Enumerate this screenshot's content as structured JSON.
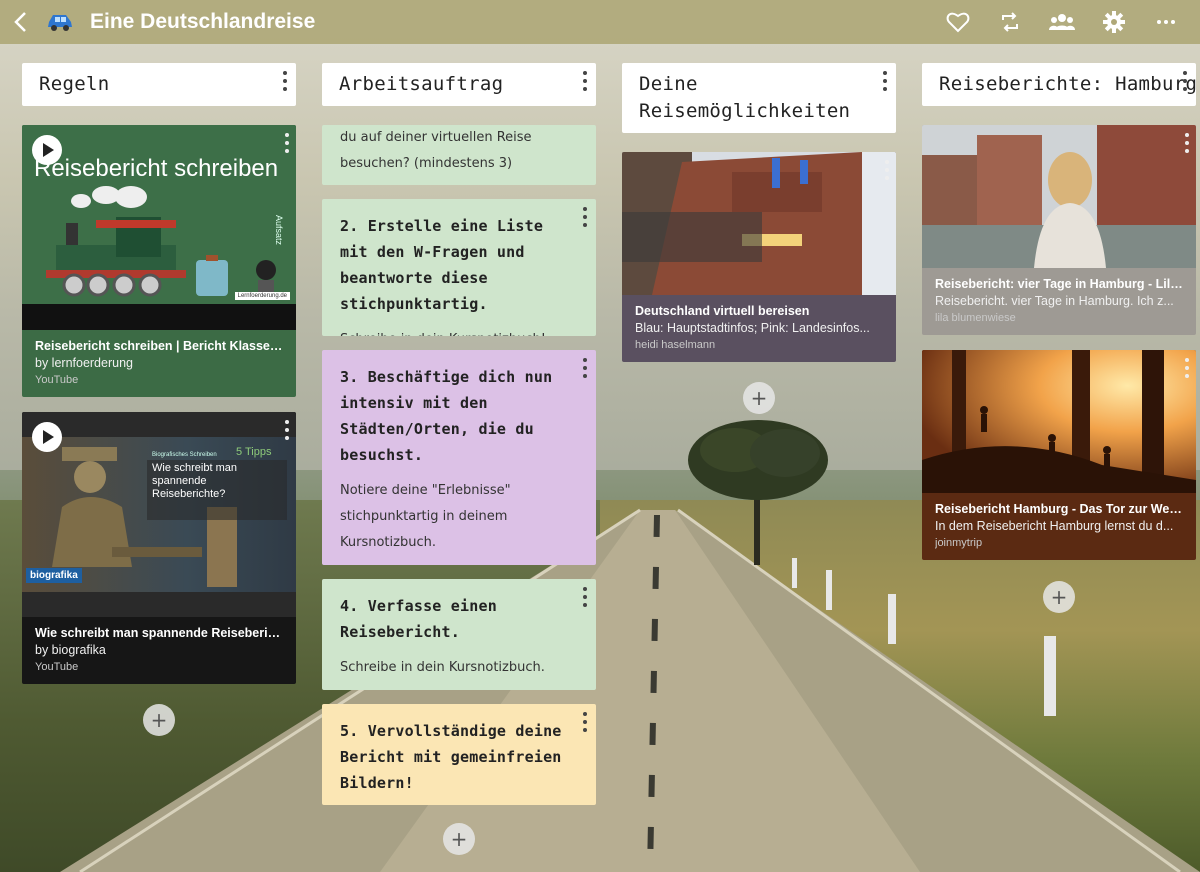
{
  "topbar": {
    "back_icon": "chevron-left-icon",
    "board_icon": "car-icon",
    "title": "Eine Deutschlandreise",
    "actions": [
      "heart-icon",
      "repeat-icon",
      "group-icon",
      "gear-icon",
      "more-icon"
    ]
  },
  "columns": [
    {
      "title": "Regeln",
      "cards": [
        {
          "type": "video",
          "thumb_title": "Reisebericht schreiben",
          "thumb_side": "Aufsatz",
          "thumb_site": "Lernfoerderung.de",
          "title": "Reisebericht schreiben | Bericht Klassen...",
          "author": "by lernfoerderung",
          "source": "YouTube"
        },
        {
          "type": "video",
          "thumb_kicker": "Biografisches Schreiben",
          "thumb_tips": "5 Tipps",
          "thumb_question": "Wie schreibt man spannende Reiseberichte?",
          "thumb_logo": "biografika",
          "title": "Wie schreibt man spannende Reiseberic...",
          "author": "by biografika",
          "source": "YouTube"
        }
      ]
    },
    {
      "title": "Arbeitsauftrag",
      "cards": [
        {
          "type": "text",
          "heading": "",
          "body": "du auf deiner virtuellen Reise besuchen? (mindestens 3)"
        },
        {
          "type": "text",
          "heading": "2. Erstelle eine Liste mit den W-Fragen und beantworte diese stichpunktartig.",
          "body": "Schreibe in dein Kursnotizbuch!"
        },
        {
          "type": "text",
          "heading": "3. Beschäftige dich nun intensiv mit den Städten/Orten, die du besuchst.",
          "body": "Notiere deine \"Erlebnisse\" stichpunktartig in deinem Kursnotizbuch."
        },
        {
          "type": "text",
          "heading": "4. Verfasse einen Reisebericht.",
          "body": "Schreibe in dein Kursnotizbuch."
        },
        {
          "type": "text",
          "heading": "5. Vervollständige deine Bericht mit gemeinfreien Bildern!",
          "body": ""
        }
      ]
    },
    {
      "title": "Deine Reisemöglichkeiten",
      "cards": [
        {
          "type": "link",
          "title": "Deutschland virtuell bereisen",
          "desc": "Blau: Hauptstadtinfos; Pink: Landesinfos...",
          "author": "heidi haselmann"
        }
      ]
    },
    {
      "title": "Reiseberichte: Hamburg",
      "cards": [
        {
          "type": "link",
          "title": "Reisebericht: vier Tage in Hamburg - Lila...",
          "desc": "Reisebericht. vier Tage in Hamburg. Ich z...",
          "author": "lila blumenwiese"
        },
        {
          "type": "link",
          "title": "Reisebericht Hamburg - Das Tor zur Welt...",
          "desc": "In dem Reisebericht Hamburg lernst du d...",
          "author": "joinmytrip"
        }
      ]
    }
  ],
  "add_label": "+",
  "colors": {
    "topbar": "#afa878",
    "green_card": "#cfe5cc",
    "purple_card": "#dcc1e6",
    "yellow_card": "#fbe6b4",
    "video1_meta": "#3c6b45",
    "video2_meta": "#161616",
    "link_reise_meta": "#5a5060",
    "link_lila_meta": "#9e9a94",
    "link_join_meta": "#5b2a12"
  }
}
